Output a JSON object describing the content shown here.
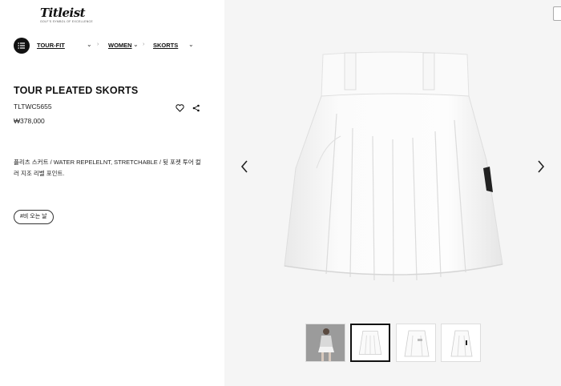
{
  "brand": {
    "name": "Titleist",
    "tagline": "GOLF'S SYMBOL OF EXCELLENCE"
  },
  "breadcrumb": {
    "items": [
      "TOUR-FIT",
      "WOMEN",
      "SKORTS"
    ]
  },
  "product": {
    "title": "TOUR PLEATED SKORTS",
    "code": "TLTWC5655",
    "price": "₩378,000",
    "description": "플리츠 스커트 / WATER REPELELNT, STRETCHABLE / 뒷 포켓 투어 컬러 지조 리벨 포인트.",
    "tag": "#비 오는 날"
  },
  "icons": {
    "menu": "menu-list-icon",
    "wishlist": "heart-icon",
    "share": "share-icon",
    "prev": "chevron-left-icon",
    "next": "chevron-right-icon",
    "breadcrumb_dropdown": "chevron-down-icon"
  },
  "gallery": {
    "thumbnails": [
      "model-front",
      "skirt-front",
      "skirt-back",
      "skirt-side"
    ],
    "active_index": 1
  },
  "colors": {
    "text": "#111111",
    "gallery_bg": "#f5f5f5",
    "product": "#ffffff"
  }
}
